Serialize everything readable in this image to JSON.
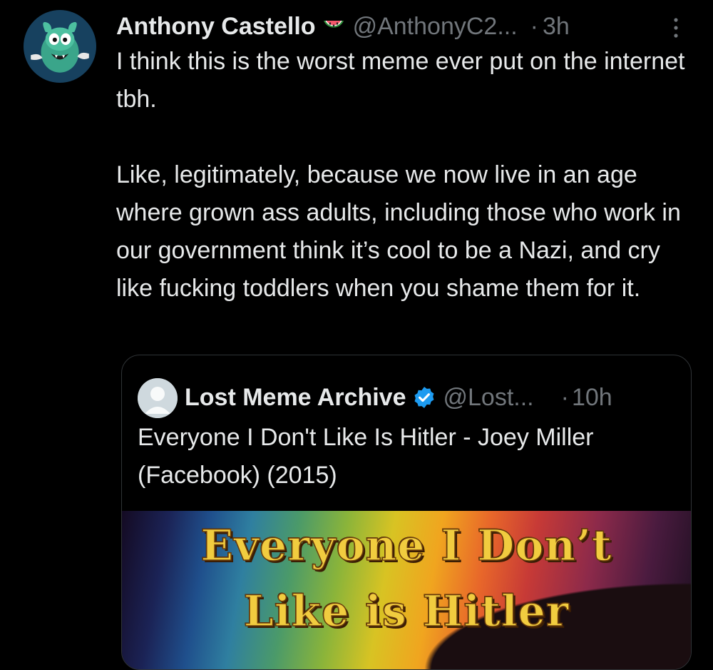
{
  "tweet": {
    "display_name": "Anthony Castello",
    "name_emoji_icon": "watermelon-icon",
    "handle": "@AnthonyC2...",
    "separator": "·",
    "time": "3h",
    "more_icon": "more-vertical-icon",
    "text": "I think this is the worst meme ever put on the internet tbh.\n\nLike, legitimately, because we now live in an age where grown ass adults, including those who work in our government think it’s cool to be a Nazi, and cry like fucking toddlers when you shame them for it."
  },
  "quoted_tweet": {
    "display_name": "Lost Meme Archive",
    "verified_icon": "verified-badge-icon",
    "handle": "@Lost...",
    "separator": "·",
    "time": "10h",
    "text": "Everyone I Don't Like Is Hitler - Joey Miller (Facebook) (2015)",
    "media": {
      "line1": "Everyone I Don’t",
      "line2": "Like is Hitler"
    }
  },
  "colors": {
    "background": "#000000",
    "primary_text": "#e7e9ea",
    "secondary_text": "#71767b",
    "border": "#2f3336",
    "verified_blue": "#1d9bf0",
    "meme_text": "#f1cc3f"
  }
}
